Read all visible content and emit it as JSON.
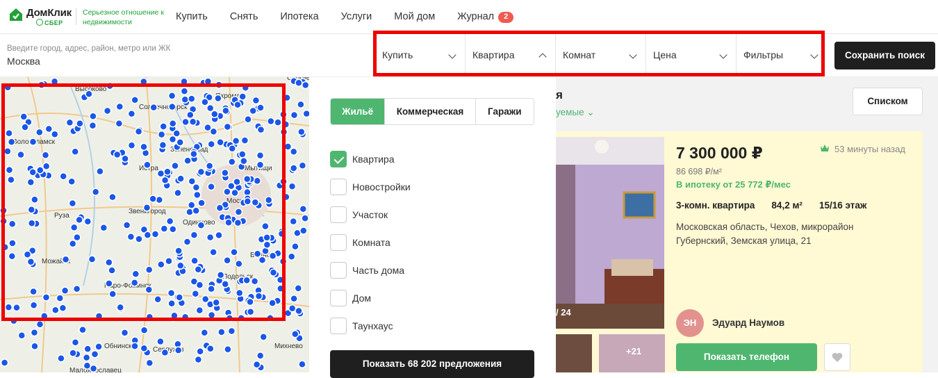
{
  "header": {
    "logo_name": "ДомКлик",
    "logo_sber": "СБЕР",
    "tagline": "Серьезное отношение к недвижимости",
    "nav": [
      {
        "label": "Купить"
      },
      {
        "label": "Снять"
      },
      {
        "label": "Ипотека"
      },
      {
        "label": "Услуги"
      },
      {
        "label": "Мой дом"
      },
      {
        "label": "Журнал",
        "badge": "2"
      }
    ]
  },
  "search": {
    "placeholder": "Введите город, адрес, район, метро или ЖК",
    "value": "Москва"
  },
  "filters": [
    {
      "label": "Купить",
      "state": "collapsed"
    },
    {
      "label": "Квартира",
      "state": "expanded"
    },
    {
      "label": "Комнат",
      "state": "collapsed"
    },
    {
      "label": "Цена",
      "state": "collapsed"
    },
    {
      "label": "Фильтры",
      "state": "collapsed"
    }
  ],
  "save_search": "Сохранить поиск",
  "map": {
    "marker_color": "#1a56e8",
    "labels": [
      "Высоково",
      "Солнечногорск",
      "Яхрома",
      "Сергиев",
      "Волоколамск",
      "Зеленоград",
      "Истра",
      "Мытищи",
      "Москва",
      "Звенигород",
      "Руза",
      "Одинцово",
      "Наро-Фоминск",
      "Подольск",
      "Можайск",
      "Серпухов",
      "Михнево",
      "Малоярославец",
      "Обнинск",
      "Видное"
    ]
  },
  "property_panel": {
    "segments": [
      {
        "label": "Жильё",
        "active": true
      },
      {
        "label": "Коммерческая",
        "active": false
      },
      {
        "label": "Гаражи",
        "active": false
      }
    ],
    "types": [
      {
        "label": "Квартира",
        "checked": true
      },
      {
        "label": "Новостройки",
        "checked": false
      },
      {
        "label": "Участок",
        "checked": false
      },
      {
        "label": "Комната",
        "checked": false
      },
      {
        "label": "Часть дома",
        "checked": false
      },
      {
        "label": "Дом",
        "checked": false
      },
      {
        "label": "Таунхаус",
        "checked": false
      }
    ],
    "show_button": "Показать 68 202 предложения"
  },
  "results": {
    "heading_fragment": "я",
    "sort_fragment": "уемые",
    "list_button": "Списком"
  },
  "listing": {
    "price": "7 300 000 ₽",
    "price_per_m2": "86 698 ₽/м²",
    "mortgage": "В ипотеку от 25 772 ₽/мес",
    "time": "53 минуты назад",
    "rooms": "3-комн. квартира",
    "area": "84,2 м²",
    "floor": "15/16 этаж",
    "address": "Московская область, Чехов, микрорайон Губернский, Земская улица, 21",
    "photo_count": "/ 24",
    "more_photos": "+21",
    "agent_initials": "ЭН",
    "agent_name": "Эдуард Наумов",
    "phone_button": "Показать телефон"
  },
  "colors": {
    "accent_green": "#4fb670",
    "brand_green": "#21a038",
    "highlight_red": "#ee0000",
    "dark_button": "#1f1f1f",
    "badge_red": "#f05a4f"
  }
}
